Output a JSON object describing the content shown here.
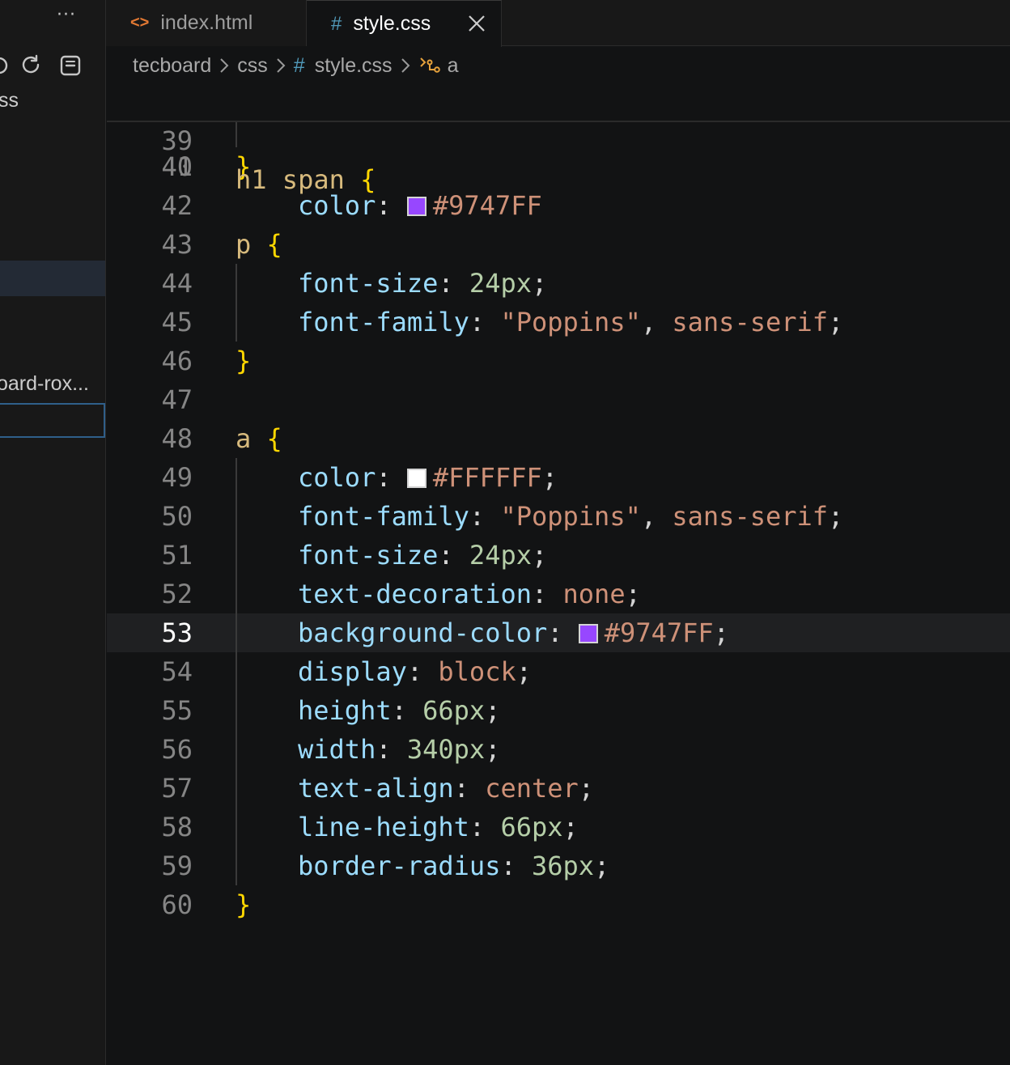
{
  "sidebar": {
    "more_label": "···",
    "partial_text_1": "ss",
    "partial_text_2": "oard-rox..."
  },
  "tabs": [
    {
      "label": "index.html",
      "icon": "html-file-icon",
      "active": false
    },
    {
      "label": "style.css",
      "icon": "css-file-icon",
      "active": true
    }
  ],
  "breadcrumb": {
    "folder1": "tecboard",
    "folder2": "css",
    "file_icon": "#",
    "file": "style.css",
    "symbol": "a"
  },
  "editor": {
    "sticky": {
      "line": "39",
      "selector": "h1 span",
      "brace": "{"
    },
    "partial": {
      "line": "40",
      "prop": "color",
      "value": "#9747FF",
      "swatch": "#9747FF"
    },
    "current_line": "53",
    "lines": [
      {
        "n": "41",
        "close": "}"
      },
      {
        "n": "42"
      },
      {
        "n": "43",
        "selector": "p",
        "open": "{"
      },
      {
        "n": "44",
        "prop": "font-size",
        "value": "24px"
      },
      {
        "n": "45",
        "prop": "font-family",
        "value1": "\"Poppins\"",
        "value2": "sans-serif"
      },
      {
        "n": "46",
        "close": "}"
      },
      {
        "n": "47"
      },
      {
        "n": "48",
        "selector": "a",
        "open": "{"
      },
      {
        "n": "49",
        "prop": "color",
        "value": "#FFFFFF",
        "swatch": "#FFFFFF"
      },
      {
        "n": "50",
        "prop": "font-family",
        "value1": "\"Poppins\"",
        "value2": "sans-serif"
      },
      {
        "n": "51",
        "prop": "font-size",
        "value": "24px"
      },
      {
        "n": "52",
        "prop": "text-decoration",
        "value": "none"
      },
      {
        "n": "53",
        "prop": "background-color",
        "value": "#9747FF",
        "swatch": "#9747FF"
      },
      {
        "n": "54",
        "prop": "display",
        "value": "block"
      },
      {
        "n": "55",
        "prop": "height",
        "value": "66px"
      },
      {
        "n": "56",
        "prop": "width",
        "value": "340px"
      },
      {
        "n": "57",
        "prop": "text-align",
        "value": "center"
      },
      {
        "n": "58",
        "prop": "line-height",
        "value": "66px"
      },
      {
        "n": "59",
        "prop": "border-radius",
        "value": "36px"
      },
      {
        "n": "60",
        "close": "}"
      }
    ],
    "punctuation": {
      "colon": ": ",
      "semicolon": ";",
      "comma": ", "
    }
  }
}
